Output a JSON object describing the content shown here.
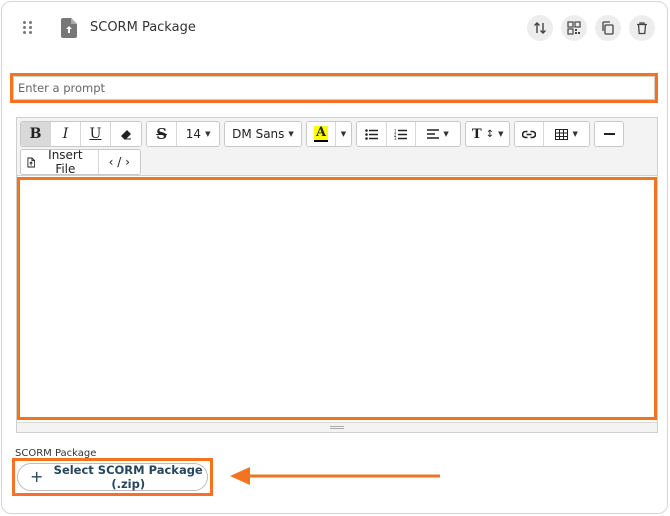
{
  "block": {
    "title": "SCORM Package",
    "actions": [
      "swap-icon",
      "qr-icon",
      "copy-icon",
      "trash-icon"
    ]
  },
  "prompt": {
    "placeholder": "Enter a prompt",
    "value": ""
  },
  "toolbar": {
    "font_size": "14",
    "font_family": "DM Sans",
    "insert_file": "Insert File",
    "code_view": "‹ / ›",
    "text_style": "T",
    "highlight_letter": "A"
  },
  "scorm": {
    "label": "SCORM Package",
    "button": "Select SCORM Package (.zip)"
  },
  "colors": {
    "highlight": "#f37321",
    "button_text": "#24465e"
  }
}
